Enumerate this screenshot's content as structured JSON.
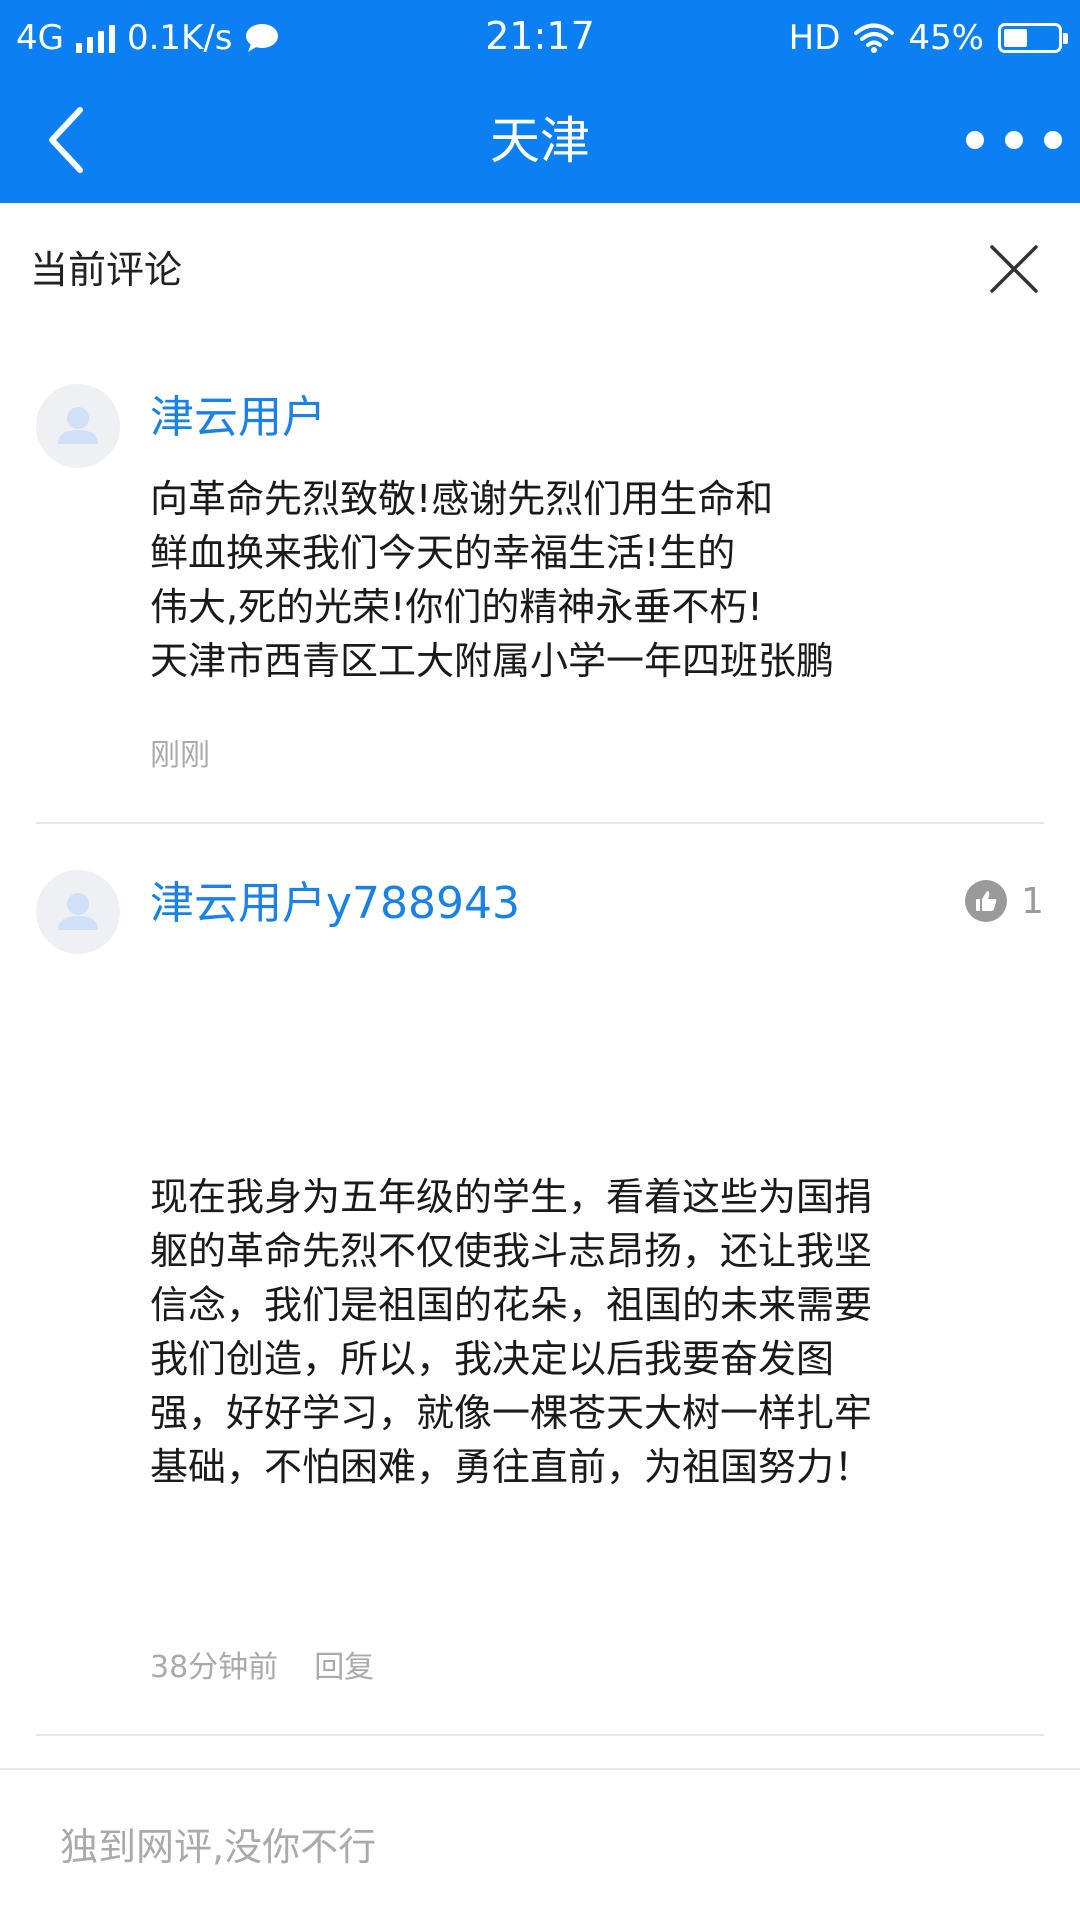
{
  "status_bar": {
    "network": "4G",
    "speed": "0.1K/s",
    "time": "21:17",
    "hd": "HD",
    "battery_pct": "45%",
    "battery_level": 0.45
  },
  "nav": {
    "title": "天津",
    "back_icon": "chevron-left-icon",
    "more_icon": "more-dots-icon"
  },
  "section": {
    "title": "当前评论",
    "close_icon": "close-icon"
  },
  "comments": [
    {
      "user": "津云用户",
      "lines": [
        "向革命先烈致敬!感谢先烈们用生命和",
        "鲜血换来我们今天的幸福生活!生的",
        "伟大,死的光荣!你们的精神永垂不朽!",
        "天津市西青区工大附属小学一年四班张鹏"
      ],
      "time": "刚刚"
    },
    {
      "user": "津云用户y788943",
      "likes": "1",
      "lines": [
        "现在我身为五年级的学生，看着这些为国捐",
        "躯的革命先烈不仅使我斗志昂扬，还让我坚",
        "信念，我们是祖国的花朵，祖国的未来需要",
        "我们创造，所以，我决定以后我要奋发图",
        "强，好好学习，就像一棵苍天大树一样扎牢",
        "基础，不怕困难，勇往直前，为祖国努力！"
      ],
      "time": "38分钟前",
      "reply": "回复"
    }
  ],
  "input": {
    "placeholder": "独到网评,没你不行"
  },
  "colors": {
    "header_bg": "#0c80f2",
    "username": "#1a82e6",
    "meta": "#aaaaaa"
  }
}
